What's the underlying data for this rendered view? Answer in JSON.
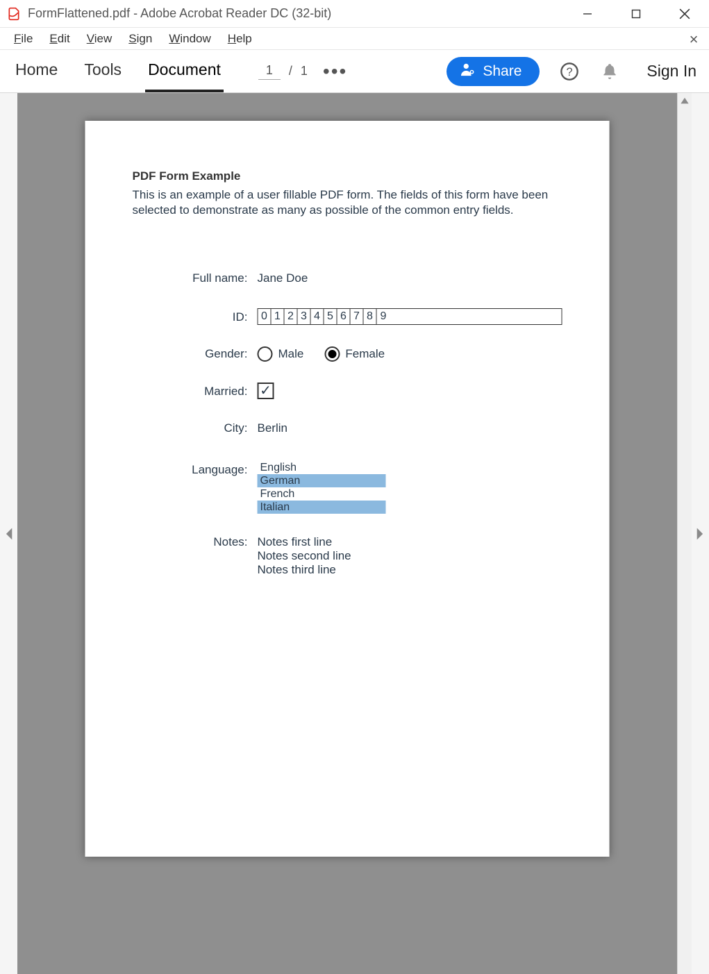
{
  "window": {
    "title": "FormFlattened.pdf - Adobe Acrobat Reader DC (32-bit)"
  },
  "menubar": {
    "file": "File",
    "edit": "Edit",
    "view": "View",
    "sign": "Sign",
    "window": "Window",
    "help": "Help",
    "close_symbol": "×"
  },
  "toolbar": {
    "home": "Home",
    "tools": "Tools",
    "document": "Document",
    "page_current": "1",
    "page_sep": "/",
    "page_total": "1",
    "more_dots": "•••",
    "share": "Share",
    "sign_in": "Sign In"
  },
  "pdf": {
    "heading": "PDF Form Example",
    "description": "This is an example of a user fillable PDF form. The fields of this form have been selected to demonstrate as many as possible of the common entry fields.",
    "fields": {
      "full_name": {
        "label": "Full name:",
        "value": "Jane Doe"
      },
      "id": {
        "label": "ID:",
        "digits": [
          "0",
          "1",
          "2",
          "3",
          "4",
          "5",
          "6",
          "7",
          "8",
          "9"
        ]
      },
      "gender": {
        "label": "Gender:",
        "options": [
          {
            "label": "Male",
            "selected": false
          },
          {
            "label": "Female",
            "selected": true
          }
        ]
      },
      "married": {
        "label": "Married:",
        "checked": true,
        "check_symbol": "✓"
      },
      "city": {
        "label": "City:",
        "value": "Berlin"
      },
      "language": {
        "label": "Language:",
        "items": [
          {
            "label": "English",
            "selected": false
          },
          {
            "label": "German",
            "selected": true
          },
          {
            "label": "French",
            "selected": false
          },
          {
            "label": "Italian",
            "selected": true
          }
        ]
      },
      "notes": {
        "label": "Notes:",
        "lines": [
          "Notes first line",
          "Notes second line",
          "Notes third line"
        ]
      }
    }
  }
}
